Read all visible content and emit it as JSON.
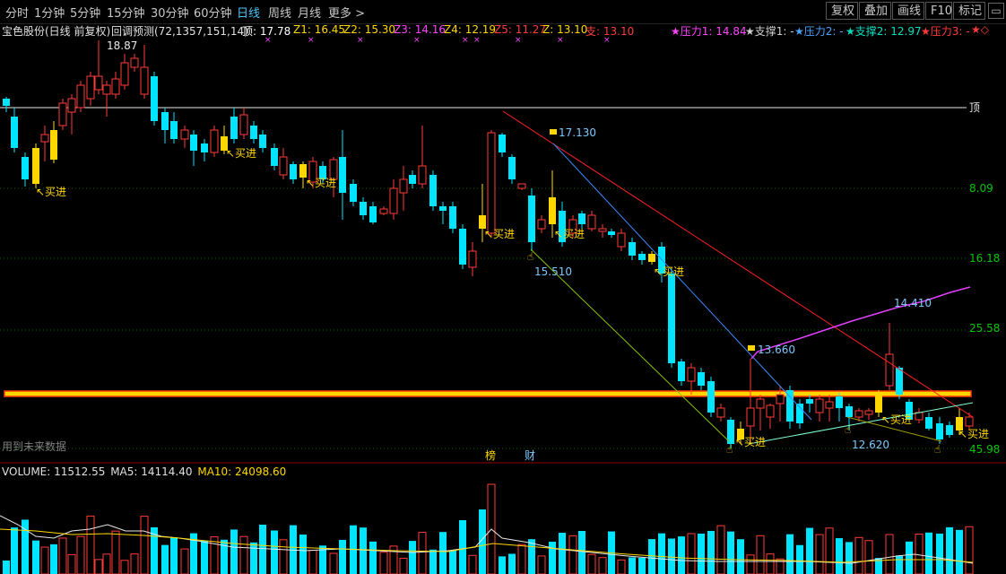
{
  "toolbar": {
    "periods": [
      "分时",
      "1分钟",
      "5分钟",
      "15分钟",
      "30分钟",
      "60分钟",
      "日线",
      "周线",
      "月线",
      "更多 >"
    ],
    "active_period": "日线",
    "buttons": [
      "复权",
      "叠加",
      "画线",
      "F10",
      "标记"
    ],
    "window_icons": [
      "restore-icon",
      "close-icon"
    ]
  },
  "info": {
    "title": "宝色股份(日线 前复权)",
    "indicator": "回调预测(72,1357,151,14)",
    "ding": "顶: 17.78",
    "z1": "Z1: 16.45",
    "z2": "Z2: 15.30",
    "z3": "Z3: 14.16",
    "z4": "Z4: 12.19",
    "z5": "Z5: 11.27",
    "z": "Z: 13.10",
    "zhi": "支: 13.10",
    "yali1": "★压力1: 14.84",
    "zhicheng1": "★支撑1: -",
    "yali2": "★压力2: -",
    "zhicheng2": "★支撑2: 12.97",
    "yali3": "★压力3: -",
    "tail": "★◇"
  },
  "colors": {
    "up": "#ff3b3b",
    "down": "#00e5ff",
    "yellow": "#ffd700",
    "magenta": "#ff44ff",
    "white": "#ffffff",
    "green_level": "#00c800",
    "orange_line": "#ff9a00"
  },
  "price_labels": {
    "high": "18.87",
    "ding_line": "顶",
    "l1": "8.09",
    "l2": "16.18",
    "l3": "25.58",
    "l4": "45.98",
    "marker_17130": "17.130",
    "marker_15510": "15.510",
    "marker_13660": "13.660",
    "marker_14410": "14.410",
    "marker_12620": "12.620",
    "future_data": "用到未来数据",
    "bang": "榜",
    "cai": "财",
    "buy": "买进"
  },
  "volume": {
    "label": "VOLUME: 11512.55",
    "ma5": "MA5: 14114.40",
    "ma10": "MA10: 24098.60"
  }
}
